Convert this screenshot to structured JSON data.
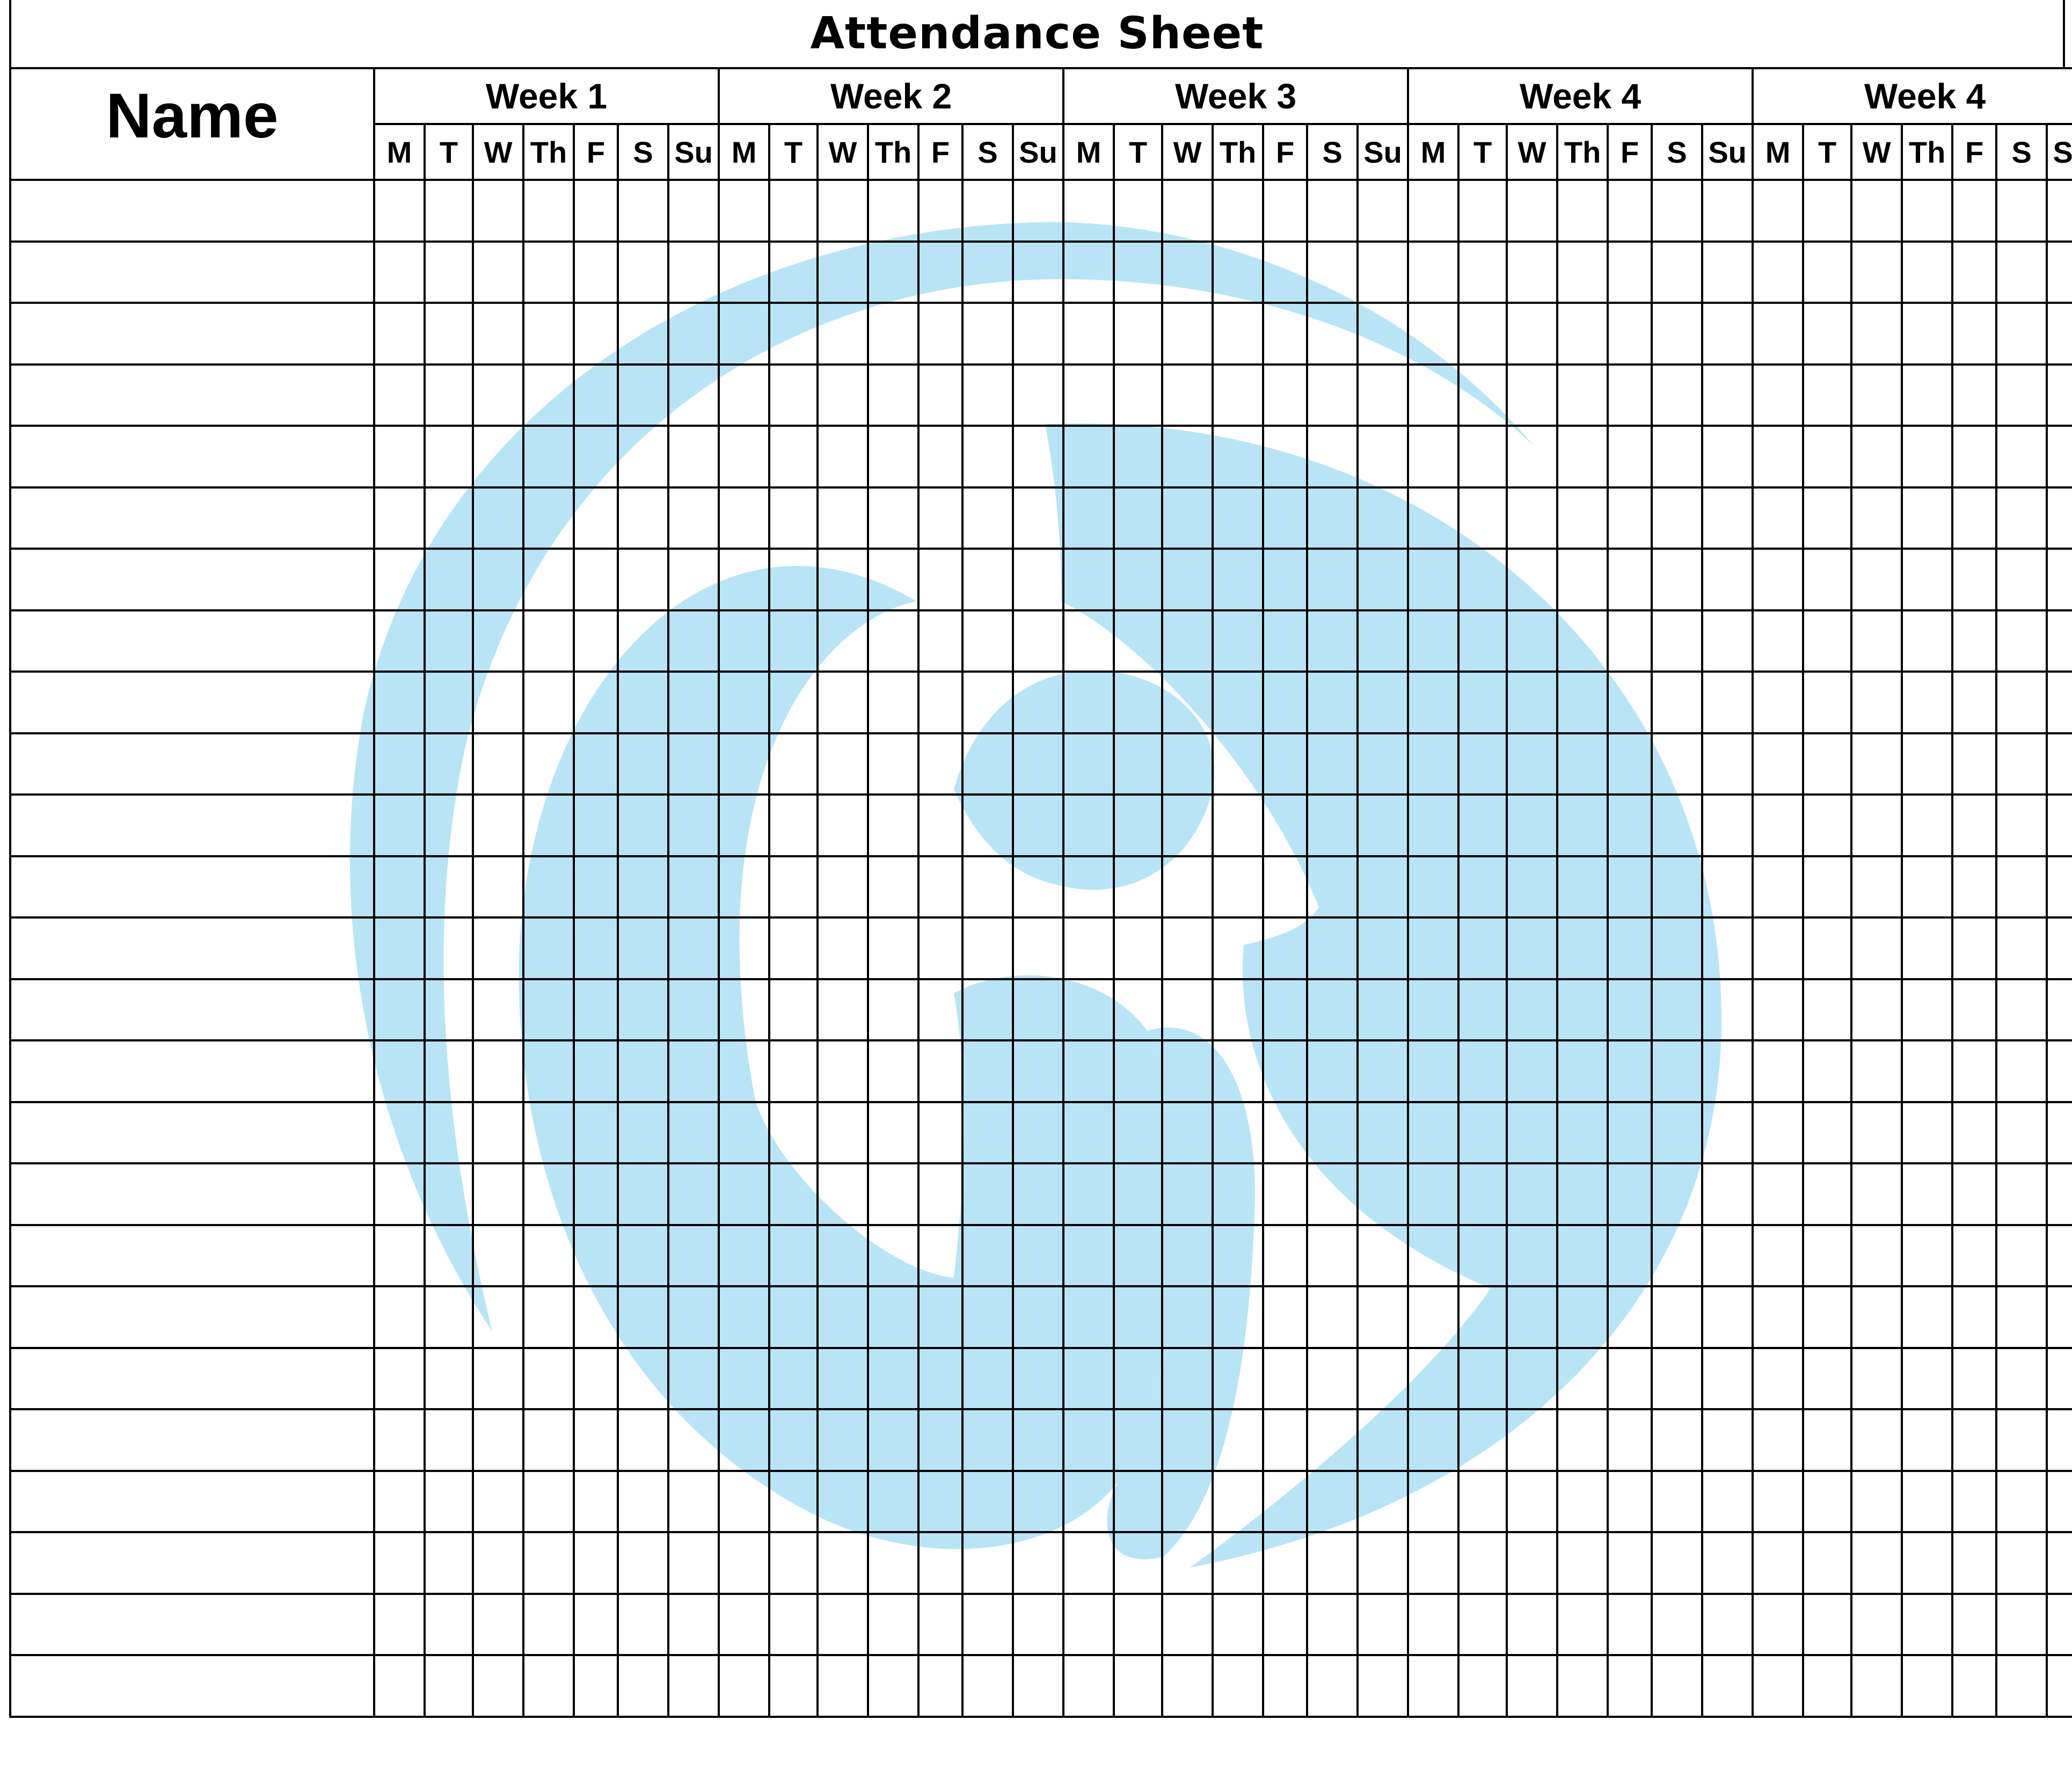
{
  "title": "Attendance Sheet",
  "name_header": "Name",
  "weeks": [
    {
      "label": "Week 1",
      "days": [
        "M",
        "T",
        "W",
        "Th",
        "F",
        "S",
        "Su"
      ]
    },
    {
      "label": "Week 2",
      "days": [
        "M",
        "T",
        "W",
        "Th",
        "F",
        "S",
        "Su"
      ]
    },
    {
      "label": "Week 3",
      "days": [
        "M",
        "T",
        "W",
        "Th",
        "F",
        "S",
        "Su"
      ]
    },
    {
      "label": "Week 4",
      "days": [
        "M",
        "T",
        "W",
        "Th",
        "F",
        "S",
        "Su"
      ]
    },
    {
      "label": "Week 4",
      "days": [
        "M",
        "T",
        "W",
        "Th",
        "F",
        "S",
        "Su"
      ]
    }
  ],
  "row_count": 25,
  "colors": {
    "watermark": "#b9e4f6",
    "grid_line": "#000000",
    "background": "#ffffff"
  },
  "icons": {
    "watermark": "logo-watermark"
  }
}
